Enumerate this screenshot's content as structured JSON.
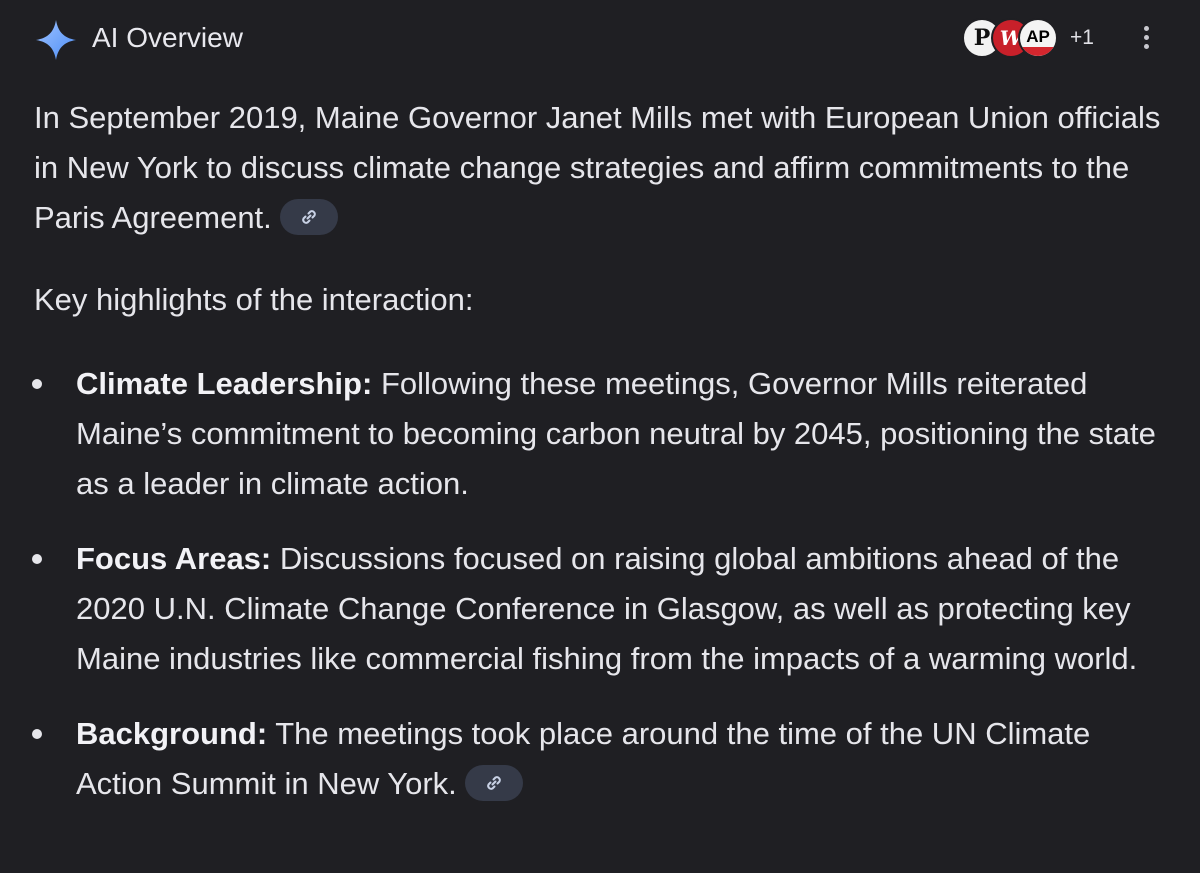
{
  "header": {
    "title": "AI Overview",
    "sparkle_icon": "sparkle-icon",
    "accent_color": "#8ab4f8",
    "sources": [
      {
        "label": "P",
        "name": "source-icon-1"
      },
      {
        "label": "W",
        "name": "source-icon-2"
      },
      {
        "label": "AP",
        "name": "source-icon-3"
      }
    ],
    "source_count": "+1",
    "menu_icon": "more-vert-icon"
  },
  "content": {
    "intro": "In September 2019, Maine Governor Janet Mills met with European Union officials in New York to discuss climate change strategies and affirm commitments to the Paris Agreement.",
    "key_heading": "Key highlights of the interaction:",
    "bullets": [
      {
        "title": "Climate Leadership:",
        "text": "Following these meetings, Governor Mills reiterated Maine’s commitment to becoming carbon neutral by 2045, positioning the state as a leader in climate action."
      },
      {
        "title": "Focus Areas:",
        "text": "Discussions focused on raising global ambitions ahead of the 2020 U.N. Climate Change Conference in Glasgow, as well as protecting key Maine industries like commercial fishing from the impacts of a warming world."
      },
      {
        "title": "Background:",
        "text": "The meetings took place around the time of the UN Climate Action Summit in New York."
      }
    ],
    "link_icon": "link-icon"
  }
}
